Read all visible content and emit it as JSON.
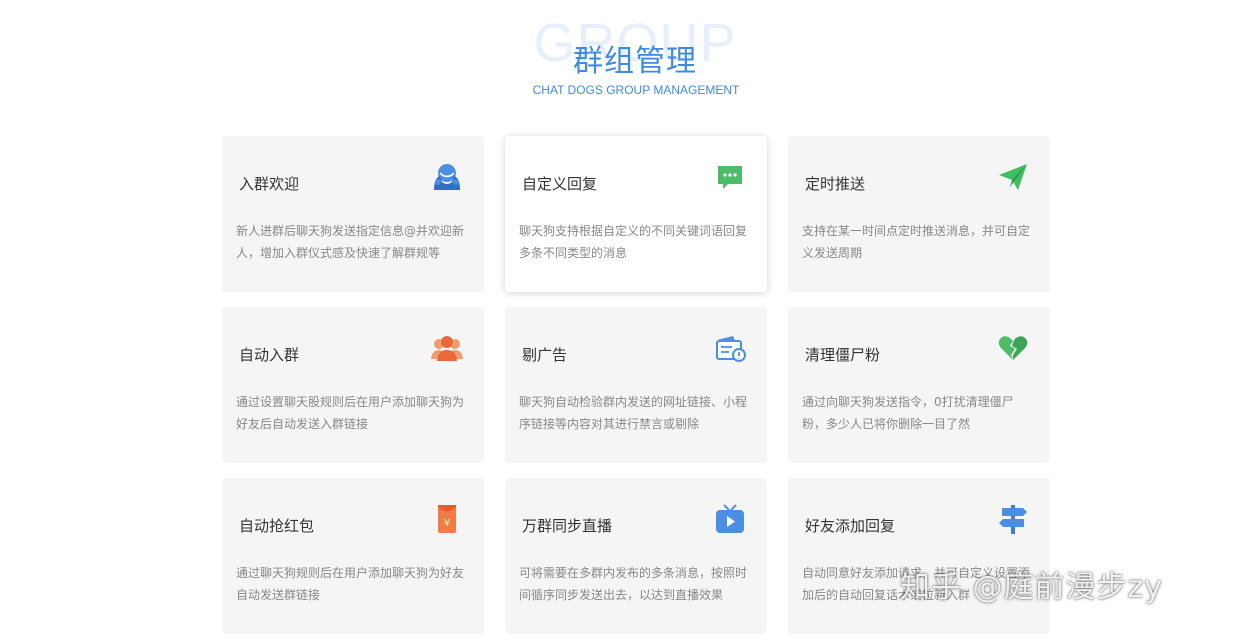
{
  "header": {
    "background_word": "GROUP",
    "title": "群组管理",
    "subtitle": "CHAT DOGS GROUP MANAGEMENT",
    "accent_color": "#3f8be2"
  },
  "cards": [
    {
      "title": "入群欢迎",
      "desc": "新人进群后聊天狗发送指定信息@并欢迎新人，增加入群仪式感及快速了解群规等",
      "icon": "welcome-person-icon"
    },
    {
      "title": "自定义回复",
      "desc": "聊天狗支持根据自定义的不同关键词语回复多条不同类型的消息",
      "icon": "chat-bubble-icon",
      "active": true
    },
    {
      "title": "定时推送",
      "desc": "支持在某一时间点定时推送消息，并可自定义发送周期",
      "icon": "paper-plane-icon"
    },
    {
      "title": "自动入群",
      "desc": "通过设置聊天股规则后在用户添加聊天狗为好友后自动发送入群链接",
      "icon": "group-people-icon"
    },
    {
      "title": "剔广告",
      "desc": "聊天狗自动检验群内发送的网址链接、小程序链接等内容对其进行禁言或剔除",
      "icon": "ad-card-icon"
    },
    {
      "title": "清理僵尸粉",
      "desc": "通过向聊天狗发送指令，0打扰清理僵尸粉，多少人已将你删除一目了然",
      "icon": "broken-heart-icon"
    },
    {
      "title": "自动抢红包",
      "desc": "通过聊天狗规则后在用户添加聊天狗为好友自动发送群链接",
      "icon": "red-envelope-icon"
    },
    {
      "title": "万群同步直播",
      "desc": "可将需要在多群内发布的多条消息，按照时间循序同步发送出去，以达到直播效果",
      "icon": "live-tv-icon"
    },
    {
      "title": "好友添加回复",
      "desc": "自动同意好友添加请求，并可自定义设置添加后的自动回复话术或拉新入群",
      "icon": "signpost-icon"
    }
  ],
  "watermark": "知乎 @庭前漫步zy"
}
